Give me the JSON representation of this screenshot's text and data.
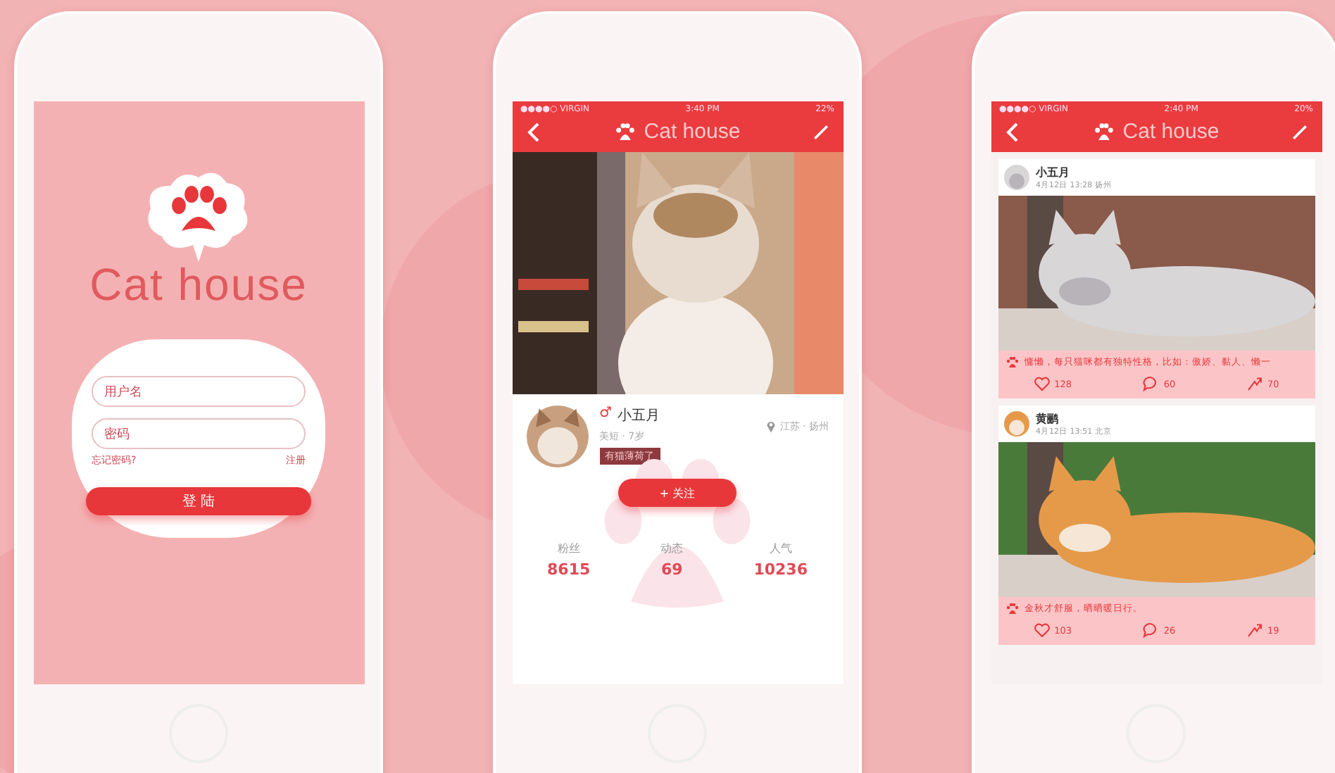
{
  "login": {
    "logo": "Cat house",
    "username": {
      "placeholder": "用户名"
    },
    "password": {
      "placeholder": "密码"
    },
    "forgot_link": "忘记密码?",
    "register_link": "注册",
    "login_button": "登 陆"
  },
  "profile": {
    "status": {
      "carrier": "●●●●○ VIRGIN",
      "time": "3:40 PM",
      "battery": "22%"
    },
    "title": "Cat house",
    "name": "小五月",
    "gender": "♂",
    "info": "美短 · 7岁",
    "tag": "有猫薄荷了",
    "location": "江苏 · 扬州",
    "follow_button": "+ 关注",
    "stats": [
      {
        "label": "粉丝",
        "value": "8615"
      },
      {
        "label": "动态",
        "value": "69"
      },
      {
        "label": "人气",
        "value": "10236"
      }
    ]
  },
  "feed": {
    "status": {
      "carrier": "●●●●○ VIRGIN",
      "time": "2:40 PM",
      "battery": "20%"
    },
    "title": "Cat house",
    "posts": [
      {
        "author": "小五月",
        "meta": "4月12日 13:28 扬州",
        "text": "慵懒，每只猫咪都有独特性格，比如：傲娇、黏人、懒一",
        "likes": "128",
        "comments": "60",
        "shares": "70"
      },
      {
        "author": "黄鹂",
        "meta": "4月12日 13:51 北京",
        "text": "金秋才舒服，晒晒暖日行。",
        "likes": "103",
        "comments": "26",
        "shares": "19"
      }
    ]
  }
}
